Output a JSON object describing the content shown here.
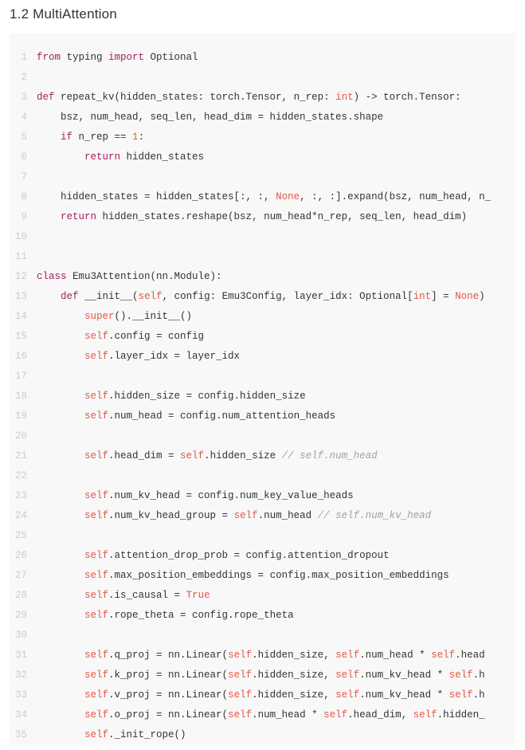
{
  "heading": "1.2 MultiAttention",
  "code": {
    "lines": [
      {
        "n": 1,
        "t": [
          [
            "hl-k",
            "from"
          ],
          [
            "",
            " typing "
          ],
          [
            "hl-k",
            "import"
          ],
          [
            "",
            " Optional"
          ]
        ]
      },
      {
        "n": 2,
        "t": [
          [
            "",
            ""
          ]
        ]
      },
      {
        "n": 3,
        "t": [
          [
            "hl-k",
            "def"
          ],
          [
            "",
            " repeat_kv(hidden_states: torch.Tensor, n_rep: "
          ],
          [
            "hl-b",
            "int"
          ],
          [
            "",
            ") -> torch.Tensor:"
          ]
        ]
      },
      {
        "n": 4,
        "t": [
          [
            "",
            "    bsz, num_head, seq_len, head_dim = hidden_states.shape"
          ]
        ]
      },
      {
        "n": 5,
        "t": [
          [
            "",
            "    "
          ],
          [
            "hl-k",
            "if"
          ],
          [
            "",
            " n_rep == "
          ],
          [
            "hl-n",
            "1"
          ],
          [
            "",
            ":"
          ]
        ]
      },
      {
        "n": 6,
        "t": [
          [
            "",
            "        "
          ],
          [
            "hl-k",
            "return"
          ],
          [
            "",
            " hidden_states"
          ]
        ]
      },
      {
        "n": 7,
        "t": [
          [
            "",
            ""
          ]
        ]
      },
      {
        "n": 8,
        "t": [
          [
            "",
            "    hidden_states = hidden_states[:, :, "
          ],
          [
            "hl-b",
            "None"
          ],
          [
            "",
            ", :, :].expand(bsz, num_head, n_"
          ]
        ]
      },
      {
        "n": 9,
        "t": [
          [
            "",
            "    "
          ],
          [
            "hl-k",
            "return"
          ],
          [
            "",
            " hidden_states.reshape(bsz, num_head*n_rep, seq_len, head_dim)"
          ]
        ]
      },
      {
        "n": 10,
        "t": [
          [
            "",
            ""
          ]
        ]
      },
      {
        "n": 11,
        "t": [
          [
            "",
            ""
          ]
        ]
      },
      {
        "n": 12,
        "t": [
          [
            "hl-k",
            "class"
          ],
          [
            "",
            " Emu3Attention(nn.Module):"
          ]
        ]
      },
      {
        "n": 13,
        "t": [
          [
            "",
            "    "
          ],
          [
            "hl-k",
            "def"
          ],
          [
            "",
            " __init__("
          ],
          [
            "hl-b",
            "self"
          ],
          [
            "",
            ", config: Emu3Config, layer_idx: Optional["
          ],
          [
            "hl-b",
            "int"
          ],
          [
            "",
            "] = "
          ],
          [
            "hl-b",
            "None"
          ],
          [
            "",
            ")"
          ]
        ]
      },
      {
        "n": 14,
        "t": [
          [
            "",
            "        "
          ],
          [
            "hl-b",
            "super"
          ],
          [
            "",
            "().__init__()"
          ]
        ]
      },
      {
        "n": 15,
        "t": [
          [
            "",
            "        "
          ],
          [
            "hl-b",
            "self"
          ],
          [
            "",
            ".config = config"
          ]
        ]
      },
      {
        "n": 16,
        "t": [
          [
            "",
            "        "
          ],
          [
            "hl-b",
            "self"
          ],
          [
            "",
            ".layer_idx = layer_idx"
          ]
        ]
      },
      {
        "n": 17,
        "t": [
          [
            "",
            ""
          ]
        ]
      },
      {
        "n": 18,
        "t": [
          [
            "",
            "        "
          ],
          [
            "hl-b",
            "self"
          ],
          [
            "",
            ".hidden_size = config.hidden_size"
          ]
        ]
      },
      {
        "n": 19,
        "t": [
          [
            "",
            "        "
          ],
          [
            "hl-b",
            "self"
          ],
          [
            "",
            ".num_head = config.num_attention_heads"
          ]
        ]
      },
      {
        "n": 20,
        "t": [
          [
            "",
            ""
          ]
        ]
      },
      {
        "n": 21,
        "t": [
          [
            "",
            "        "
          ],
          [
            "hl-b",
            "self"
          ],
          [
            "",
            ".head_dim = "
          ],
          [
            "hl-b",
            "self"
          ],
          [
            "",
            ".hidden_size "
          ],
          [
            "hl-c",
            "// self.num_head"
          ]
        ]
      },
      {
        "n": 22,
        "t": [
          [
            "",
            ""
          ]
        ]
      },
      {
        "n": 23,
        "t": [
          [
            "",
            "        "
          ],
          [
            "hl-b",
            "self"
          ],
          [
            "",
            ".num_kv_head = config.num_key_value_heads"
          ]
        ]
      },
      {
        "n": 24,
        "t": [
          [
            "",
            "        "
          ],
          [
            "hl-b",
            "self"
          ],
          [
            "",
            ".num_kv_head_group = "
          ],
          [
            "hl-b",
            "self"
          ],
          [
            "",
            ".num_head "
          ],
          [
            "hl-c",
            "// self.num_kv_head"
          ]
        ]
      },
      {
        "n": 25,
        "t": [
          [
            "",
            ""
          ]
        ]
      },
      {
        "n": 26,
        "t": [
          [
            "",
            "        "
          ],
          [
            "hl-b",
            "self"
          ],
          [
            "",
            ".attention_drop_prob = config.attention_dropout"
          ]
        ]
      },
      {
        "n": 27,
        "t": [
          [
            "",
            "        "
          ],
          [
            "hl-b",
            "self"
          ],
          [
            "",
            ".max_position_embeddings = config.max_position_embeddings"
          ]
        ]
      },
      {
        "n": 28,
        "t": [
          [
            "",
            "        "
          ],
          [
            "hl-b",
            "self"
          ],
          [
            "",
            ".is_causal = "
          ],
          [
            "hl-b",
            "True"
          ]
        ]
      },
      {
        "n": 29,
        "t": [
          [
            "",
            "        "
          ],
          [
            "hl-b",
            "self"
          ],
          [
            "",
            ".rope_theta = config.rope_theta"
          ]
        ]
      },
      {
        "n": 30,
        "t": [
          [
            "",
            ""
          ]
        ]
      },
      {
        "n": 31,
        "t": [
          [
            "",
            "        "
          ],
          [
            "hl-b",
            "self"
          ],
          [
            "",
            ".q_proj = nn.Linear("
          ],
          [
            "hl-b",
            "self"
          ],
          [
            "",
            ".hidden_size, "
          ],
          [
            "hl-b",
            "self"
          ],
          [
            "",
            ".num_head * "
          ],
          [
            "hl-b",
            "self"
          ],
          [
            "",
            ".head"
          ]
        ]
      },
      {
        "n": 32,
        "t": [
          [
            "",
            "        "
          ],
          [
            "hl-b",
            "self"
          ],
          [
            "",
            ".k_proj = nn.Linear("
          ],
          [
            "hl-b",
            "self"
          ],
          [
            "",
            ".hidden_size, "
          ],
          [
            "hl-b",
            "self"
          ],
          [
            "",
            ".num_kv_head * "
          ],
          [
            "hl-b",
            "self"
          ],
          [
            "",
            ".h"
          ]
        ]
      },
      {
        "n": 33,
        "t": [
          [
            "",
            "        "
          ],
          [
            "hl-b",
            "self"
          ],
          [
            "",
            ".v_proj = nn.Linear("
          ],
          [
            "hl-b",
            "self"
          ],
          [
            "",
            ".hidden_size, "
          ],
          [
            "hl-b",
            "self"
          ],
          [
            "",
            ".num_kv_head * "
          ],
          [
            "hl-b",
            "self"
          ],
          [
            "",
            ".h"
          ]
        ]
      },
      {
        "n": 34,
        "t": [
          [
            "",
            "        "
          ],
          [
            "hl-b",
            "self"
          ],
          [
            "",
            ".o_proj = nn.Linear("
          ],
          [
            "hl-b",
            "self"
          ],
          [
            "",
            ".num_head * "
          ],
          [
            "hl-b",
            "self"
          ],
          [
            "",
            ".head_dim, "
          ],
          [
            "hl-b",
            "self"
          ],
          [
            "",
            ".hidden_"
          ]
        ]
      },
      {
        "n": 35,
        "t": [
          [
            "",
            "        "
          ],
          [
            "hl-b",
            "self"
          ],
          [
            "",
            "._init_rope()"
          ]
        ]
      }
    ]
  }
}
